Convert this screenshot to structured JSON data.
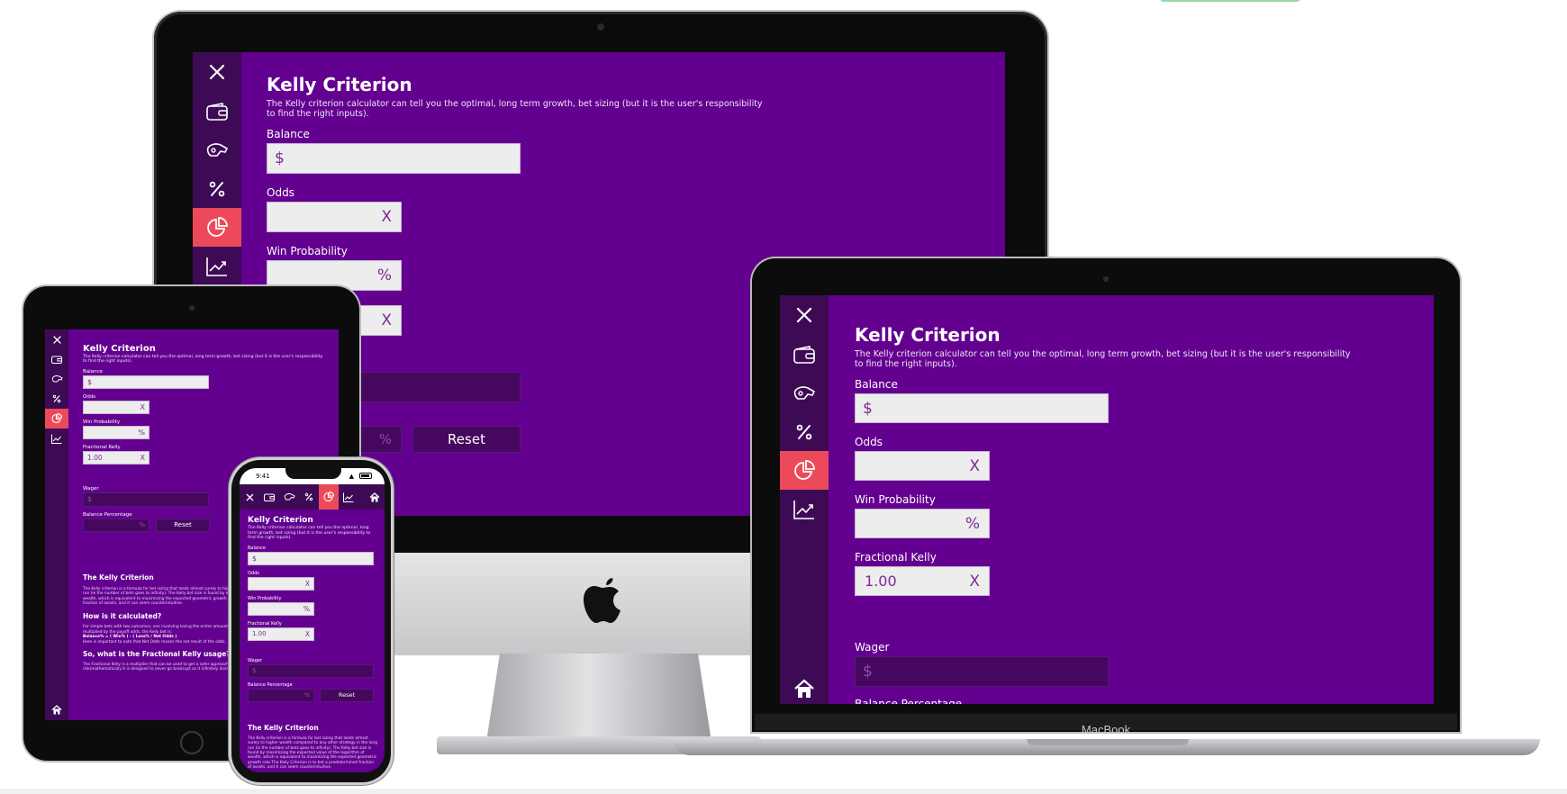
{
  "app": {
    "title": "Kelly Criterion",
    "description": "The Kelly criterion calculator can tell you the optimal, long term growth, bet sizing (but it is the user's responsibility to find the right inputs).",
    "balance": {
      "label": "Balance",
      "prefix": "$",
      "value": ""
    },
    "odds": {
      "label": "Odds",
      "suffix": "X",
      "value": ""
    },
    "win_probability": {
      "label": "Win Probability",
      "suffix": "%",
      "value": ""
    },
    "fractional_kelly": {
      "label": "Fractional Kelly",
      "value": "1.00",
      "suffix": "X"
    },
    "wager": {
      "label": "Wager",
      "prefix": "$"
    },
    "balance_percentage": {
      "label": "Balance Percentage",
      "suffix": "%"
    },
    "reset_label": "Reset",
    "nav": [
      "close-icon",
      "wallet-icon",
      "horse-head-icon",
      "percent-icon",
      "pie-chart-icon",
      "trend-chart-icon",
      "home-icon"
    ],
    "active_nav": "pie-chart-icon"
  },
  "article": {
    "h1": "The Kelly Criterion",
    "p1": "The Kelly criterion is a formula for bet sizing that leads almost surely to higher wealth compared to any other strategy in the long run (ie the number of bets goes to infinity). The Kelly bet size is found by maximizing the expected value of the logarithm of wealth, which is equivalent to maximizing the expected geometric growth rate.The Kelly Criterion is to bet a predetermined fraction of assets, and it can seem counterintuitive.",
    "h2": "How is it calculated?",
    "p2": "For simple bets with two outcomes, one involving losing the entire amount bet, and the other involving winning the bet amount multiplied by the payoff odds, the Kelly bet is:",
    "formula": "Balance% = ( Win% ) - ( Loss% / Net Odds )",
    "p3": "Here is important to note that Net Odds means the net result of the odds.",
    "h3": "So, what is the Fractional Kelly usage?",
    "p4": "The Fractional Kelly is a multiplier that can be used to get a safer approach, as the Kelly Criterion can seem too much of a risk(mathematically it is designed to never go bankrupt as it infinitely divides wager and unlimited amounts of bets)."
  },
  "phone": {
    "time": "9:41"
  },
  "device": {
    "laptop_brand": "MacBook"
  },
  "colors": {
    "app_bg": "#630090",
    "rail_bg": "#3e0a56",
    "active_nav": "#ec4a5a",
    "input_bg": "#ededed",
    "input_text": "#7b2a96",
    "dark_field": "#46075f"
  }
}
